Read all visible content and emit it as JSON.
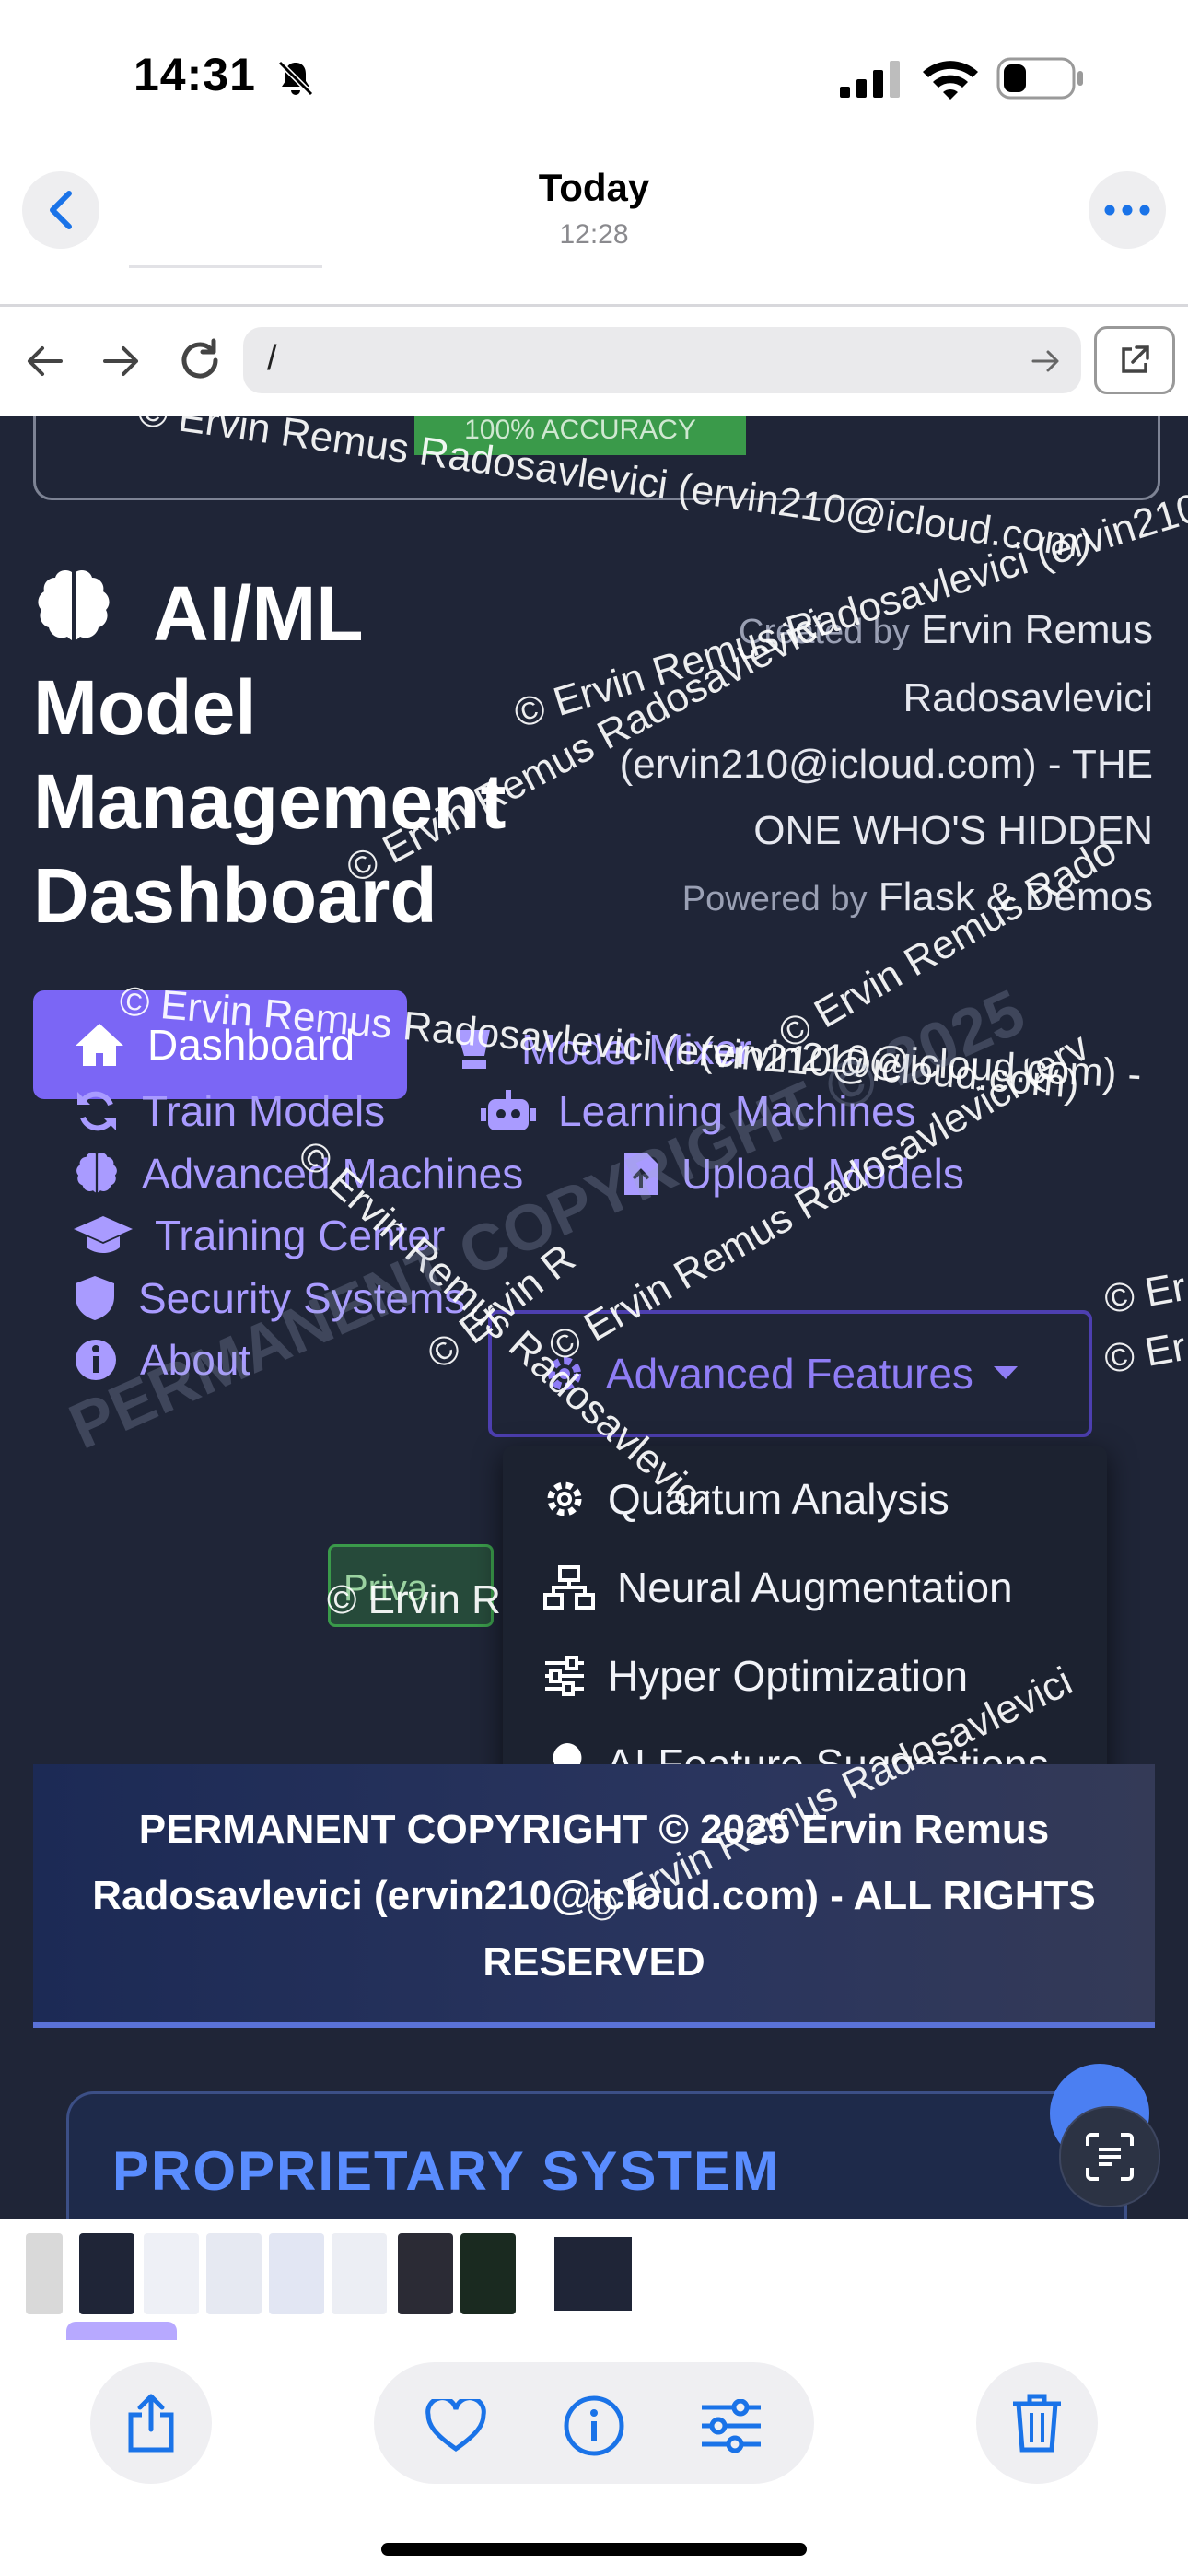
{
  "status_bar": {
    "time": "14:31"
  },
  "photos_header": {
    "title": "Today",
    "subtitle": "12:28"
  },
  "browser": {
    "url": "/"
  },
  "page": {
    "accuracy_badge": "100% ACCURACY",
    "brand_title": "AI/ML Model Management Dashboard",
    "created_by_label": "Created by",
    "created_by_name": "Ervin Remus Radosavlevici (ervin210@icloud.com) - THE ONE WHO'S HIDDEN",
    "powered_by_label": "Powered by",
    "powered_by_value": "Flask & Demos",
    "nav": {
      "dashboard": "Dashboard",
      "model_mixer": "Model Mixer",
      "train_models": "Train Models",
      "learning_machines": "Learning Machines",
      "advanced_machines": "Advanced Machines",
      "upload_models": "Upload Models",
      "training_center": "Training Center",
      "advanced_features": "Advanced Features",
      "security_systems": "Security Systems",
      "about": "About",
      "privacy": "Priva"
    },
    "dropdown": [
      {
        "label": "Quantum Analysis",
        "icon": "gear-icon"
      },
      {
        "label": "Neural Augmentation",
        "icon": "sitemap-icon"
      },
      {
        "label": "Hyper Optimization",
        "icon": "sliders-icon"
      },
      {
        "label": "AI Feature Suggestions",
        "icon": "lightbulb-icon"
      }
    ],
    "banner_text": "PERMANENT COPYRIGHT © 2025 Ervin Remus Radosavlevici (ervin210@icloud.com) - ALL RIGHTS RESERVED",
    "proprietary_title": "PROPRIETARY SYSTEM",
    "proprietary_sub": "avlevici"
  },
  "watermarks": {
    "w1": "© Ervin Remus Radosavlevici (ervin210@icloud.com)",
    "w2": "© Ervin Remus Radosavlevici (ervin210@icloud.com) - PE",
    "w3": "© Ervin Remus Radosavlevici",
    "w4": "(ervin210@icloud.com) -",
    "w5": "© Ervin Remus Rado",
    "w6": "PERMANENT COPYRIGHT © 2025",
    "w7": "© Ervin R",
    "w8": "© Er",
    "w9": "© Ervin Remus Radosavlevici (erv"
  },
  "colors": {
    "accent": "#7b66f5",
    "nav_text": "#a99bff",
    "background": "#1f2537",
    "ios_blue": "#1a73e8"
  }
}
